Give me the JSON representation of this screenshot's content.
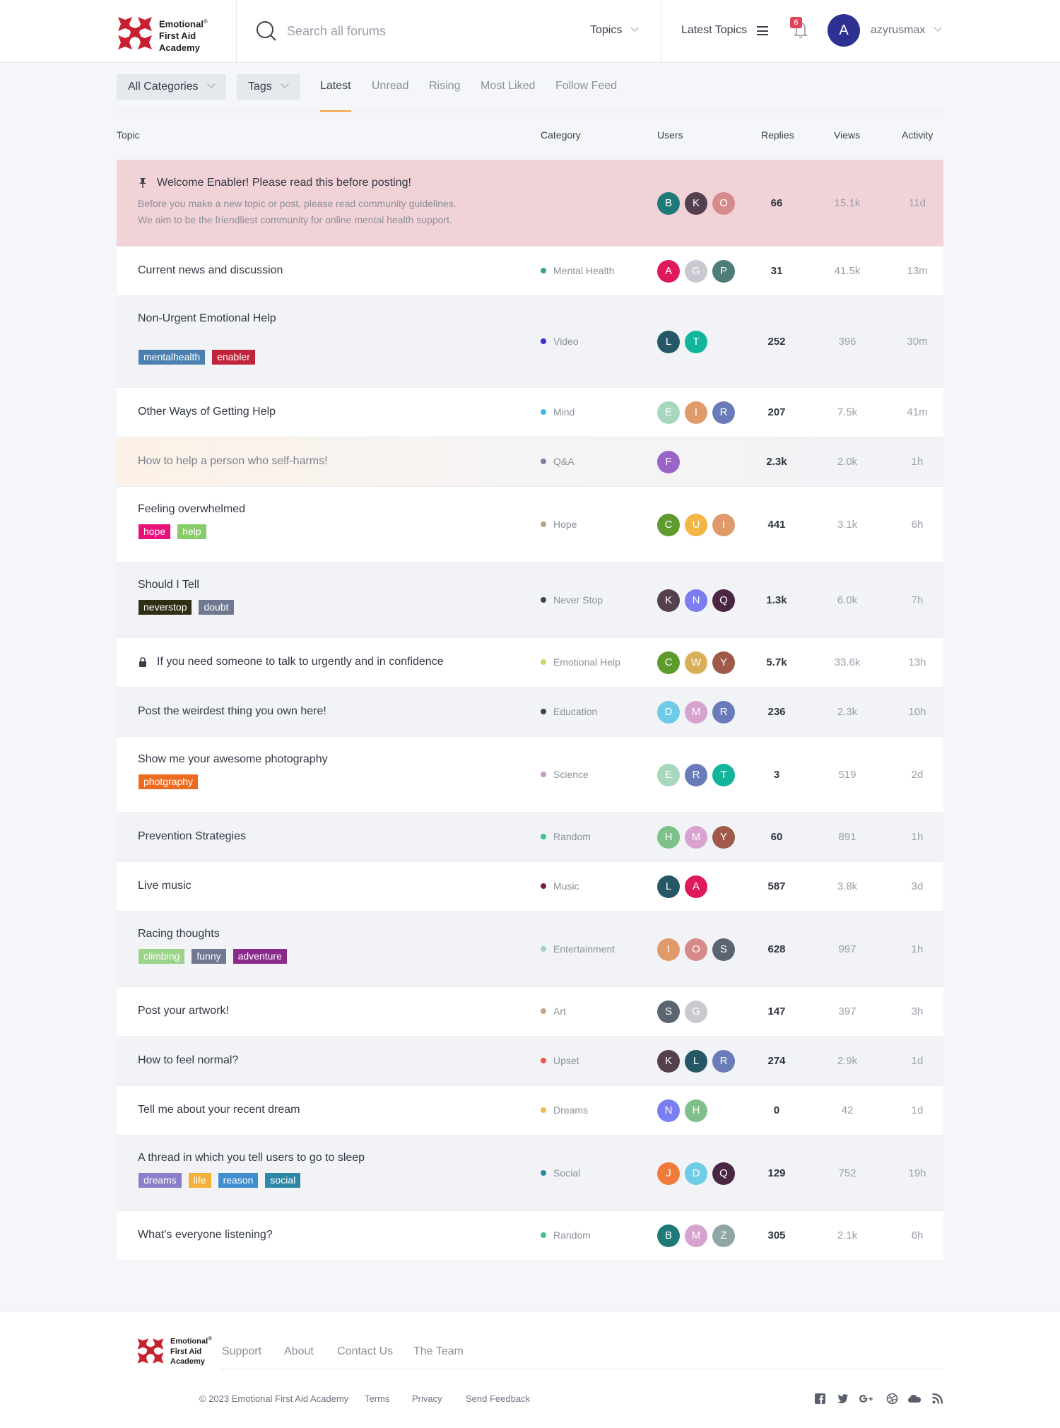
{
  "header": {
    "brand_line1": "Emotional",
    "brand_line2": "First Aid",
    "brand_line3": "Academy",
    "brand_mark": "®",
    "search_placeholder": "Search all forums",
    "topics_label": "Topics",
    "latest_topics_label": "Latest Topics",
    "notifications_count": "6",
    "avatar_initial": "A",
    "username": "azyrusmax"
  },
  "filters": {
    "all_categories": "All Categories",
    "tags": "Tags",
    "tabs": [
      "Latest",
      "Unread",
      "Rising",
      "Most Liked",
      "Follow Feed"
    ]
  },
  "table": {
    "headers": {
      "topic": "Topic",
      "category": "Category",
      "users": "Users",
      "replies": "Replies",
      "views": "Views",
      "activity": "Activity"
    },
    "pinned": {
      "title": "Welcome Enabler! Please read this before posting!",
      "desc1": "Before you make a new topic or post, please read community guidelines.",
      "desc2": "We aim to be the friendliest community for online mental health support.",
      "avatars": [
        {
          "l": "B",
          "c": "#1f7a77"
        },
        {
          "l": "K",
          "c": "#54404f"
        },
        {
          "l": "O",
          "c": "#d78a8a"
        }
      ],
      "replies": "66",
      "views": "15.1k",
      "activity": "11d"
    },
    "rows": [
      {
        "title": "Current news and discussion",
        "category": "Mental Health",
        "cat_color": "#3aa195",
        "avatars": [
          {
            "l": "A",
            "c": "#e0195a"
          },
          {
            "l": "G",
            "c": "#c9c9d1"
          },
          {
            "l": "P",
            "c": "#4e7c78"
          }
        ],
        "replies": "31",
        "views": "41.5k",
        "activity": "13m",
        "tags": []
      },
      {
        "title": "Non-Urgent Emotional Help",
        "category": "Video",
        "cat_color": "#3b2fd3",
        "avatars": [
          {
            "l": "L",
            "c": "#255766"
          },
          {
            "l": "T",
            "c": "#12b59c"
          }
        ],
        "replies": "252",
        "views": "396",
        "activity": "30m",
        "tags": [
          {
            "t": "mentalhealth",
            "c": "#4a7fb0"
          },
          {
            "t": "enabler",
            "c": "#c0243a"
          }
        ]
      },
      {
        "title": "Other Ways of Getting Help",
        "category": "Mind",
        "cat_color": "#45b7e6",
        "avatars": [
          {
            "l": "E",
            "c": "#a7d8be"
          },
          {
            "l": "I",
            "c": "#e09a6a"
          },
          {
            "l": "R",
            "c": "#6a7bb9"
          }
        ],
        "replies": "207",
        "views": "7.5k",
        "activity": "41m",
        "tags": []
      },
      {
        "title": "How to help a person who self-harms!",
        "category": "Q&A",
        "cat_color": "#7a7fa2",
        "avatars": [
          {
            "l": "F",
            "c": "#9a63c8"
          }
        ],
        "replies": "2.3k",
        "views": "2.0k",
        "activity": "1h",
        "tags": []
      },
      {
        "title": "Feeling overwhelmed",
        "category": "Hope",
        "cat_color": "#b8a088",
        "avatars": [
          {
            "l": "C",
            "c": "#5e9b2c"
          },
          {
            "l": "U",
            "c": "#f3b544"
          },
          {
            "l": "I",
            "c": "#e09a6a"
          }
        ],
        "replies": "441",
        "views": "3.1k",
        "activity": "6h",
        "tags": [
          {
            "t": "hope",
            "c": "#e8117a"
          },
          {
            "t": "help",
            "c": "#86cd6a"
          }
        ]
      },
      {
        "title": "Should I Tell",
        "category": "Never Stop",
        "cat_color": "#3d4450",
        "avatars": [
          {
            "l": "K",
            "c": "#54404f"
          },
          {
            "l": "N",
            "c": "#7b7ef0"
          },
          {
            "l": "Q",
            "c": "#4a2642"
          }
        ],
        "replies": "1.3k",
        "views": "6.0k",
        "activity": "7h",
        "tags": [
          {
            "t": "neverstop",
            "c": "#2f2f16"
          },
          {
            "t": "doubt",
            "c": "#707891"
          }
        ]
      },
      {
        "title": "If you need someone to talk to urgently and in confidence",
        "category": "Emotional Help",
        "cat_color": "#bde06a",
        "avatars": [
          {
            "l": "C",
            "c": "#5e9b2c"
          },
          {
            "l": "W",
            "c": "#d8b058"
          },
          {
            "l": "Y",
            "c": "#a05a4a"
          }
        ],
        "replies": "5.7k",
        "views": "33.6k",
        "activity": "13h",
        "tags": [],
        "locked": true
      },
      {
        "title": "Post the weirdest thing you own here!",
        "category": "Education",
        "cat_color": "#3d4450",
        "avatars": [
          {
            "l": "D",
            "c": "#6fcbe6"
          },
          {
            "l": "M",
            "c": "#d6a3cf"
          },
          {
            "l": "R",
            "c": "#6a7bb9"
          }
        ],
        "replies": "236",
        "views": "2.3k",
        "activity": "10h",
        "tags": []
      },
      {
        "title": "Show me your awesome photography",
        "category": "Science",
        "cat_color": "#c49ac9",
        "avatars": [
          {
            "l": "E",
            "c": "#a7d8be"
          },
          {
            "l": "R",
            "c": "#6a7bb9"
          },
          {
            "l": "T",
            "c": "#12b59c"
          }
        ],
        "replies": "3",
        "views": "519",
        "activity": "2d",
        "tags": [
          {
            "t": "photgraphy",
            "c": "#ee6a1f"
          }
        ]
      },
      {
        "title": "Prevention Strategies",
        "category": "Random",
        "cat_color": "#44c08a",
        "avatars": [
          {
            "l": "H",
            "c": "#80c08a"
          },
          {
            "l": "M",
            "c": "#d6a3cf"
          },
          {
            "l": "Y",
            "c": "#a05a4a"
          }
        ],
        "replies": "60",
        "views": "891",
        "activity": "1h",
        "tags": []
      },
      {
        "title": "Live music",
        "category": "Music",
        "cat_color": "#7a1f3f",
        "avatars": [
          {
            "l": "L",
            "c": "#255766"
          },
          {
            "l": "A",
            "c": "#e0195a"
          }
        ],
        "replies": "587",
        "views": "3.8k",
        "activity": "3d",
        "tags": []
      },
      {
        "title": "Racing thoughts",
        "category": "Entertainment",
        "cat_color": "#9ed4be",
        "avatars": [
          {
            "l": "I",
            "c": "#e09a6a"
          },
          {
            "l": "O",
            "c": "#d78a8a"
          },
          {
            "l": "S",
            "c": "#5a6570"
          }
        ],
        "replies": "628",
        "views": "997",
        "activity": "1h",
        "tags": [
          {
            "t": "climbing",
            "c": "#9bd38a"
          },
          {
            "t": "funny",
            "c": "#707891"
          },
          {
            "t": "adventure",
            "c": "#8a2a8a"
          }
        ]
      },
      {
        "title": "Post your artwork!",
        "category": "Art",
        "cat_color": "#c4a882",
        "avatars": [
          {
            "l": "S",
            "c": "#5a6570"
          },
          {
            "l": "G",
            "c": "#c9c9d1"
          }
        ],
        "replies": "147",
        "views": "397",
        "activity": "3h",
        "tags": []
      },
      {
        "title": "How to feel normal?",
        "category": "Upset",
        "cat_color": "#ee5a4a",
        "avatars": [
          {
            "l": "K",
            "c": "#54404f"
          },
          {
            "l": "L",
            "c": "#255766"
          },
          {
            "l": "R",
            "c": "#6a7bb9"
          }
        ],
        "replies": "274",
        "views": "2.9k",
        "activity": "1d",
        "tags": []
      },
      {
        "title": "Tell me about your recent dream",
        "category": "Dreams",
        "cat_color": "#f3b85a",
        "avatars": [
          {
            "l": "N",
            "c": "#7b7ef0"
          },
          {
            "l": "H",
            "c": "#80c08a"
          }
        ],
        "replies": "0",
        "views": "42",
        "activity": "1d",
        "tags": []
      },
      {
        "title": "A thread in which you tell users to go to sleep",
        "category": "Social",
        "cat_color": "#2f87a8",
        "avatars": [
          {
            "l": "J",
            "c": "#f07a3a"
          },
          {
            "l": "D",
            "c": "#6fcbe6"
          },
          {
            "l": "Q",
            "c": "#4a2642"
          }
        ],
        "replies": "129",
        "views": "752",
        "activity": "19h",
        "tags": [
          {
            "t": "dreams",
            "c": "#8a7fc8"
          },
          {
            "t": "life",
            "c": "#f4b13a"
          },
          {
            "t": "reason",
            "c": "#3f8ed0"
          },
          {
            "t": "social",
            "c": "#2f87a8"
          }
        ]
      },
      {
        "title": "What's everyone listening?",
        "category": "Random",
        "cat_color": "#44c08a",
        "avatars": [
          {
            "l": "B",
            "c": "#1f7a77"
          },
          {
            "l": "M",
            "c": "#d6a3cf"
          },
          {
            "l": "Z",
            "c": "#8fa6a6"
          }
        ],
        "replies": "305",
        "views": "2.1k",
        "activity": "6h",
        "tags": []
      }
    ]
  },
  "footer": {
    "links": [
      "Support",
      "About",
      "Contact Us",
      "The Team"
    ],
    "copyright": "© 2023 Emotional First Aid Academy",
    "small_links": [
      "Terms",
      "Privacy",
      "Send Feedback"
    ],
    "social_icons": [
      "facebook-icon",
      "twitter-icon",
      "google-plus-icon",
      "dribbble-icon",
      "cloud-icon",
      "rss-icon"
    ]
  }
}
